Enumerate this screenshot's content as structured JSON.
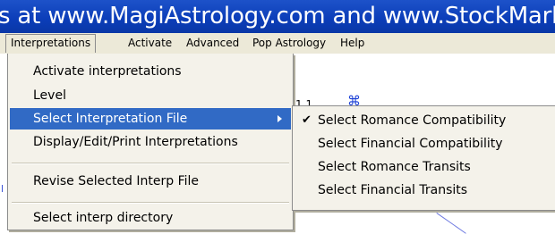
{
  "window": {
    "title": "s at www.MagiAstrology.com and www.StockMarketCo"
  },
  "menubar": {
    "items": [
      {
        "label": "Interpretations"
      },
      {
        "label": "Activate"
      },
      {
        "label": "Advanced"
      },
      {
        "label": "Pop Astrology"
      },
      {
        "label": "Help"
      }
    ]
  },
  "canvas": {
    "label": "1.1",
    "glyph": "⌘"
  },
  "interpretations_menu": {
    "items": [
      {
        "label": "Activate interpretations"
      },
      {
        "label": "Level"
      },
      {
        "label": "Select Interpretation File"
      },
      {
        "label": "Display/Edit/Print Interpretations"
      },
      {
        "label": "Revise Selected Interp File"
      },
      {
        "label": "Select interp directory"
      }
    ]
  },
  "submenu": {
    "checkmark": "✔",
    "items": [
      {
        "label": "Select Romance Compatibility"
      },
      {
        "label": "Select Financial Compatibility"
      },
      {
        "label": "Select Romance Transits"
      },
      {
        "label": "Select Financial Transits"
      }
    ]
  },
  "colors": {
    "titlebar": "#0b3db8",
    "menu_highlight": "#316ac5",
    "menu_bg": "#f4f2ea"
  }
}
